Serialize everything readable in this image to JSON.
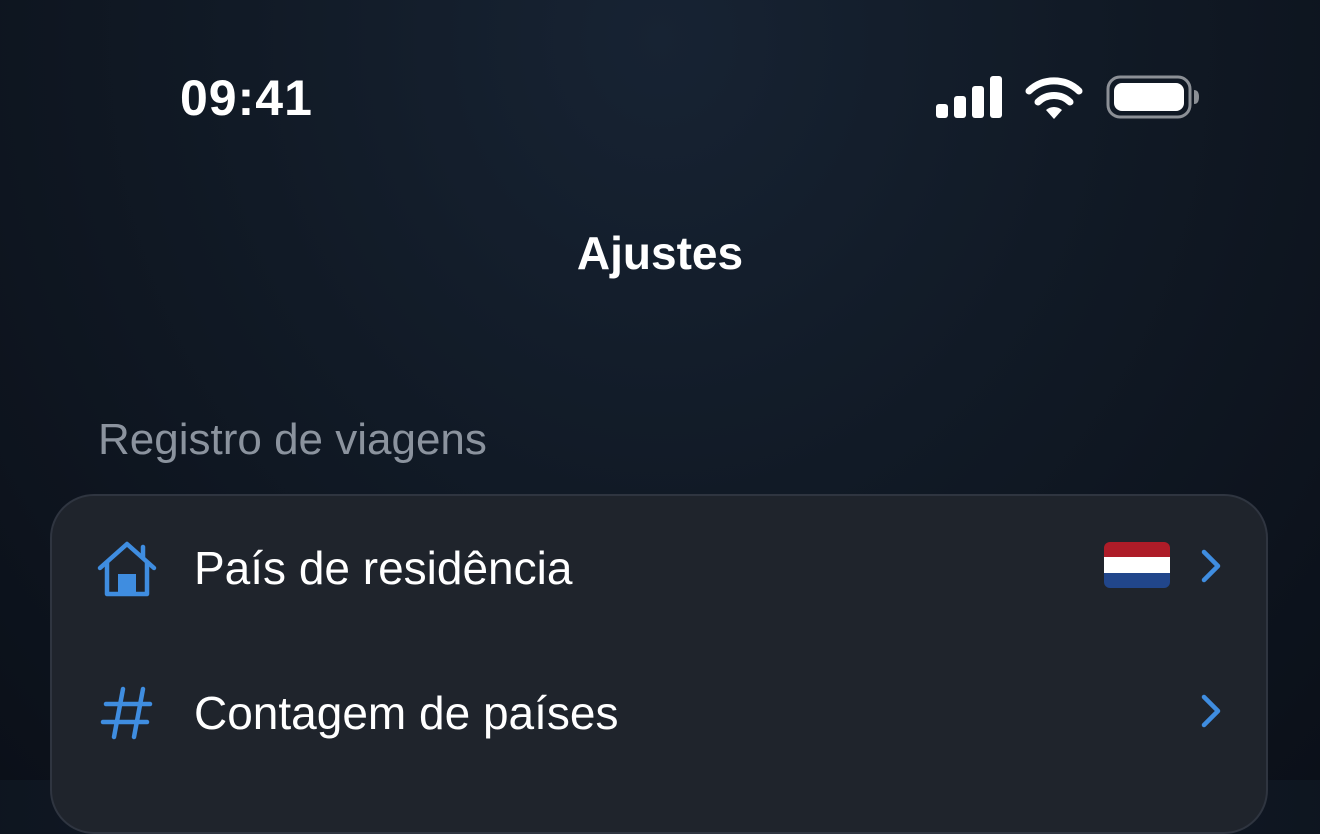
{
  "status_bar": {
    "time": "09:41",
    "icons": [
      "signal-icon",
      "wifi-icon",
      "battery-icon"
    ]
  },
  "navigation": {
    "title": "Ajustes"
  },
  "sections": [
    {
      "header": "Registro de viagens",
      "rows": [
        {
          "icon": "house-icon",
          "label": "País de residência",
          "value_icon": "netherlands-flag-icon",
          "accessory": "chevron-right-icon"
        },
        {
          "icon": "hash-icon",
          "label": "Contagem de países",
          "accessory": "chevron-right-icon"
        }
      ]
    }
  ],
  "colors": {
    "accent": "#3f8de0",
    "background": "#111a26",
    "card": "#1f242c",
    "secondary_text": "#8b939e",
    "flag_red": "#ae1c28",
    "flag_white": "#ffffff",
    "flag_blue": "#21468b"
  }
}
